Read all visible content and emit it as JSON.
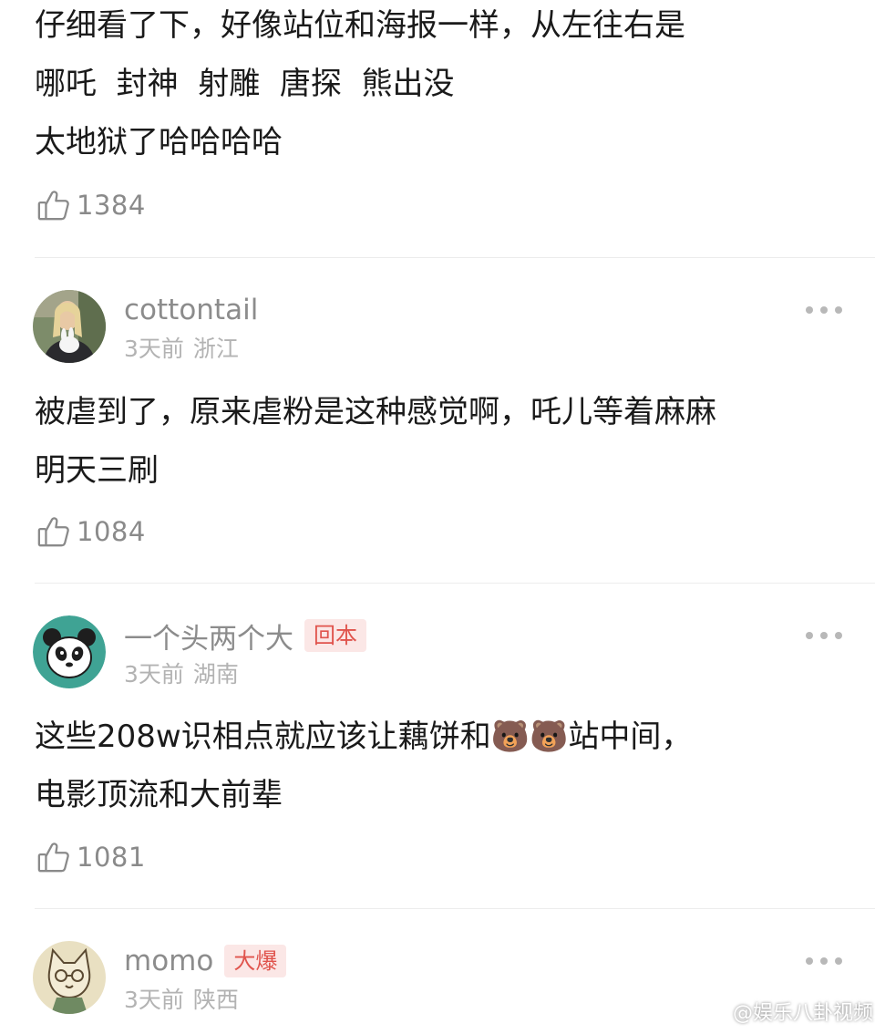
{
  "comments": [
    {
      "text_lines": [
        "仔细看了下，好像站位和海报一样，从左往右是",
        "哪吒  封神  射雕  唐探  熊出没",
        "太地狱了哈哈哈哈"
      ],
      "likes": "1384"
    },
    {
      "username": "cottontail",
      "tag": "",
      "time": "3天前",
      "region": "浙江",
      "text_lines": [
        "被虐到了，原来虐粉是这种感觉啊，吒儿等着麻麻",
        "明天三刷"
      ],
      "likes": "1084"
    },
    {
      "username": "一个头两个大",
      "tag": "回本",
      "time": "3天前",
      "region": "湖南",
      "text_lines": [
        "这些208w识相点就应该让藕饼和🐻🐻站中间，",
        "电影顶流和大前辈"
      ],
      "likes": "1081"
    },
    {
      "username": "momo",
      "tag": "大爆",
      "time": "3天前",
      "region": "陕西"
    }
  ],
  "watermark": "@娱乐八卦视频",
  "icons": {
    "like": "thumbs-up-icon",
    "more": "more-dots-icon",
    "watermark": "weibo-logo-icon"
  },
  "colors": {
    "text": "#1a1a1a",
    "meta": "#b3b3b3",
    "username": "#8c8c8c",
    "tag_bg": "#fbe7e6",
    "tag_text": "#e0544d"
  }
}
